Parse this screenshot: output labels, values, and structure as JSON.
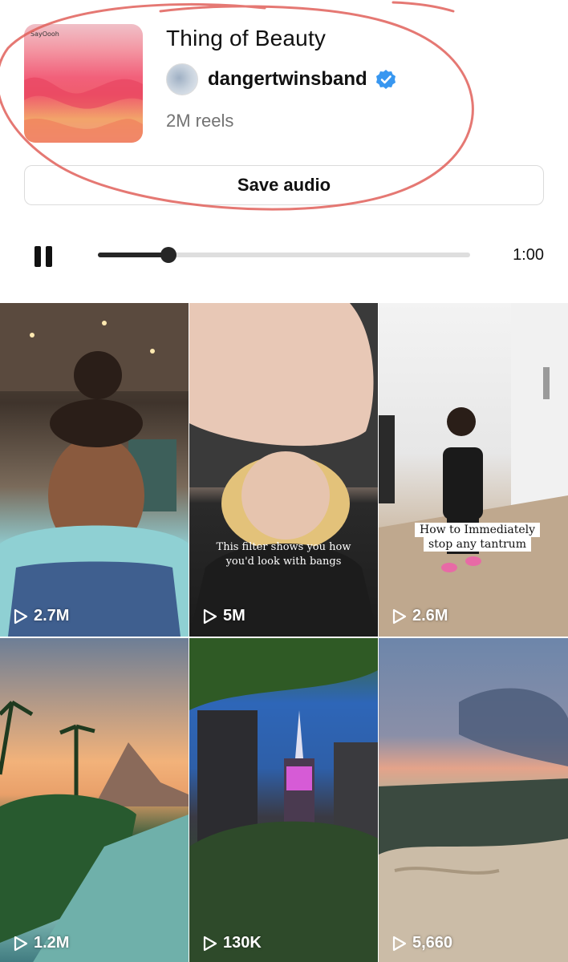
{
  "audio": {
    "title": "Thing of Beauty",
    "artist": "dangertwinsband",
    "verified": true,
    "reels_count": "2M reels",
    "cover_label": "SayOooh"
  },
  "actions": {
    "save_label": "Save audio"
  },
  "player": {
    "state": "playing",
    "progress_fraction": 0.19,
    "duration": "1:00"
  },
  "reels": [
    {
      "views": "2.7M",
      "caption": ""
    },
    {
      "views": "5M",
      "caption": "This filter shows you how you'd look with bangs"
    },
    {
      "views": "2.6M",
      "caption": "How to Immediately stop any tantrum"
    },
    {
      "views": "1.2M",
      "caption": ""
    },
    {
      "views": "130K",
      "caption": ""
    },
    {
      "views": "5,660",
      "caption": ""
    }
  ],
  "colors": {
    "verified_blue": "#3897f0",
    "annotation_red": "#e0605a",
    "secondary_text": "#737373"
  },
  "icons": {
    "pause": "pause-icon",
    "play": "play-icon",
    "verified": "verified-badge-icon"
  }
}
